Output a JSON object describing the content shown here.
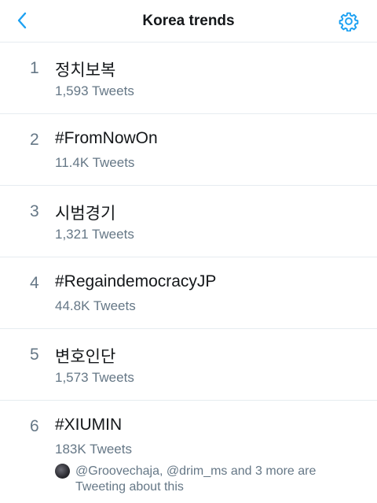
{
  "header": {
    "title": "Korea trends"
  },
  "trends": [
    {
      "rank": "1",
      "name": "정치보복",
      "count": "1,593 Tweets"
    },
    {
      "rank": "2",
      "name": "#FromNowOn",
      "count": "11.4K Tweets"
    },
    {
      "rank": "3",
      "name": "시범경기",
      "count": "1,321 Tweets"
    },
    {
      "rank": "4",
      "name": "#RegaindemocracyJP",
      "count": "44.8K Tweets"
    },
    {
      "rank": "5",
      "name": "변호인단",
      "count": "1,573 Tweets"
    },
    {
      "rank": "6",
      "name": "#XIUMIN",
      "count": "183K Tweets",
      "context": "@Groovechaja, @drim_ms and 3 more are Tweeting about this"
    }
  ],
  "colors": {
    "accent": "#1da1f2",
    "secondary_text": "#657786",
    "divider": "#e6ecf0"
  }
}
